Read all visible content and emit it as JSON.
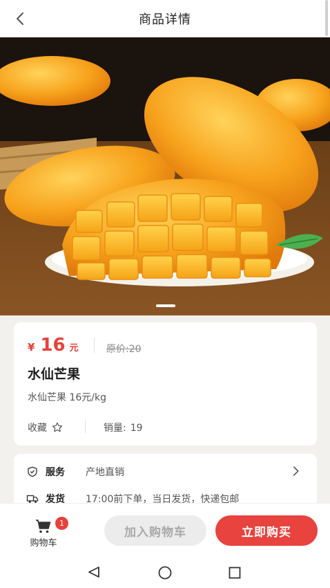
{
  "header": {
    "title": "商品详情"
  },
  "icons": {
    "back": "chevron-left-icon",
    "favorite": "star-outline-icon",
    "service": "shield-icon",
    "delivery": "truck-icon",
    "arrow": "chevron-right-icon",
    "cart": "cart-icon"
  },
  "carousel": {
    "image_alt": "mango-photo"
  },
  "product": {
    "price_symbol": "¥",
    "price": "16",
    "price_unit": "元",
    "original_price": "原价:20",
    "name": "水仙芒果",
    "description": "水仙芒果 16元/kg",
    "favorite_label": "收藏",
    "sales_label": "销量:",
    "sales_count": "19"
  },
  "services": {
    "service_label": "服务",
    "service_value": "产地直销",
    "delivery_label": "发货",
    "delivery_value": "17:00前下单，当日发货，快递包邮"
  },
  "bottom_bar": {
    "cart_label": "购物车",
    "cart_badge": "1",
    "add_to_cart": "加入购物车",
    "buy_now": "立即购买"
  },
  "colors": {
    "accent": "#e8403a",
    "disabled_button": "#ececec"
  }
}
